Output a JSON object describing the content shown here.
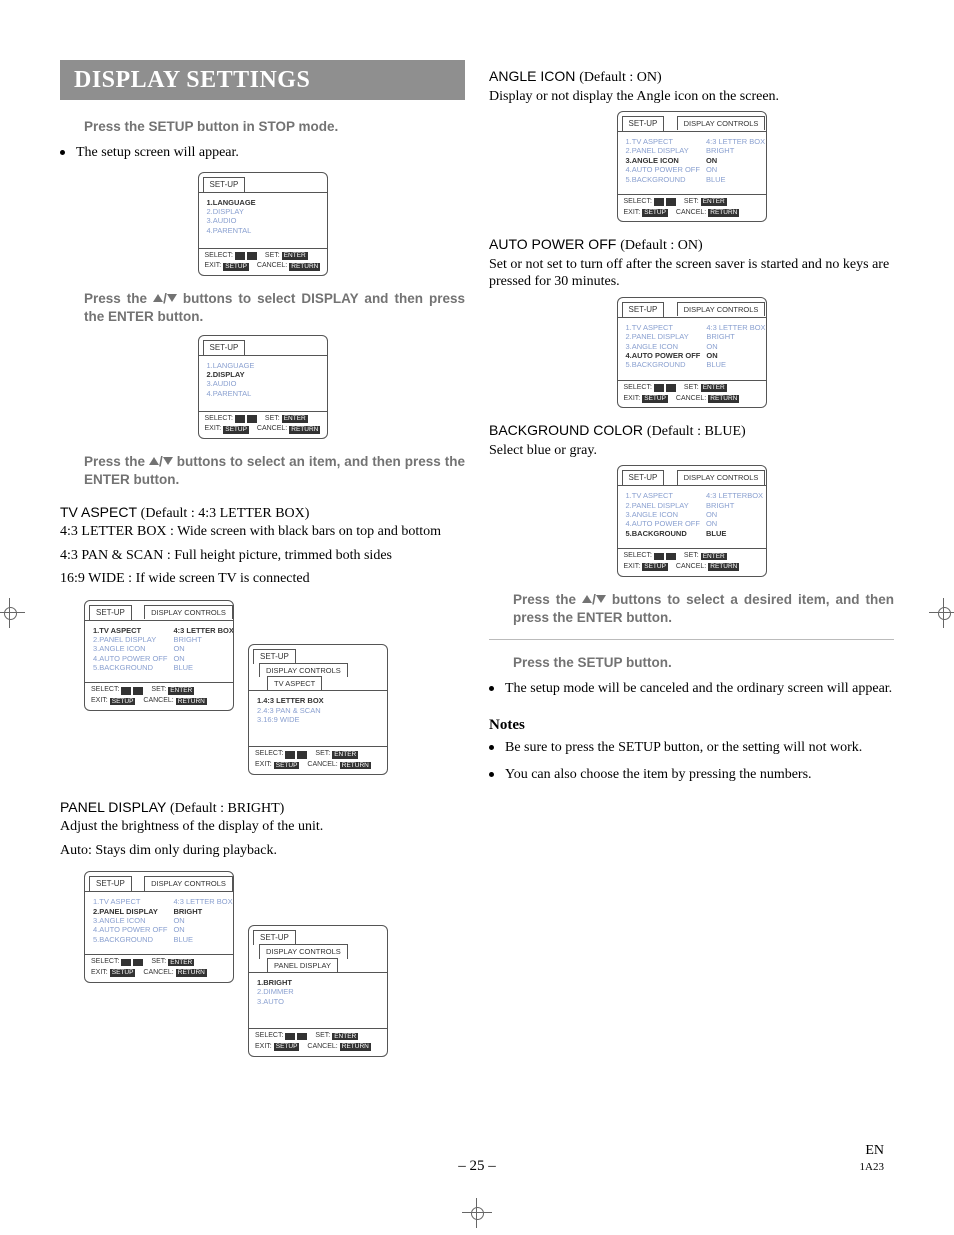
{
  "banner": "DISPLAY SETTINGS",
  "left": {
    "step1": "Press the SETUP button in STOP mode.",
    "step1_note": "The setup screen will appear.",
    "step2_a": "Press the ",
    "step2_b": " buttons to select DISPLAY and then press the ENTER button.",
    "step3_a": "Press the ",
    "step3_b": " buttons to select an item, and then press the ENTER button.",
    "tvaspect": {
      "title": "TV ASPECT",
      "def": "(Default : 4:3 LETTER BOX)",
      "l1": "4:3 LETTER BOX : Wide screen with black bars on top and bottom",
      "l2": "4:3 PAN & SCAN : Full height picture, trimmed both sides",
      "l3": "16:9 WIDE : If wide screen TV is connected"
    },
    "panel": {
      "title": "PANEL DISPLAY",
      "def": "(Default : BRIGHT)",
      "l1": "Adjust the brightness of the display of the unit.",
      "l2": "Auto: Stays dim only during playback."
    }
  },
  "right": {
    "angle": {
      "title": "ANGLE ICON",
      "def": "(Default : ON)",
      "body": "Display or not display the Angle icon on the screen."
    },
    "auto": {
      "title": "AUTO POWER OFF",
      "def": "(Default : ON)",
      "body": "Set or not set to turn off after the screen saver is started and no keys are pressed for 30 minutes."
    },
    "bg": {
      "title": "BACKGROUND COLOR",
      "def": "(Default : BLUE)",
      "body": "Select blue or gray."
    },
    "step4_a": "Press the ",
    "step4_b": " buttons to select a desired item, and then press the ENTER button.",
    "step5": "Press the SETUP button.",
    "step5_note": "The setup mode will be canceled and the ordinary screen will appear.",
    "notes": "Notes",
    "note1": "Be sure to press the SETUP button, or the setting will not work.",
    "note2": "You can also choose the item by pressing the numbers."
  },
  "osd": {
    "setup": "SET-UP",
    "dispctrl": "DISPLAY CONTROLS",
    "tvaspect_tab": "TV ASPECT",
    "paneldisp_tab": "PANEL DISPLAY",
    "mainmenu": [
      "1.LANGUAGE",
      "2.DISPLAY",
      "3.AUDIO",
      "4.PARENTAL"
    ],
    "dispmenu": {
      "rows": [
        {
          "k": "1.TV ASPECT",
          "v": "4:3 LETTER BOX"
        },
        {
          "k": "2.PANEL DISPLAY",
          "v": "BRIGHT"
        },
        {
          "k": "3.ANGLE ICON",
          "v": "ON"
        },
        {
          "k": "4.AUTO POWER OFF",
          "v": "ON"
        },
        {
          "k": "5.BACKGROUND",
          "v": "BLUE"
        }
      ]
    },
    "dispmenu_lb": {
      "rows": [
        {
          "k": "1.TV ASPECT",
          "v": "4:3 LETTERBOX"
        },
        {
          "k": "2.PANEL DISPLAY",
          "v": "BRIGHT"
        },
        {
          "k": "3.ANGLE ICON",
          "v": "ON"
        },
        {
          "k": "4.AUTO POWER OFF",
          "v": "ON"
        },
        {
          "k": "5.BACKGROUND",
          "v": "BLUE"
        }
      ]
    },
    "tvaspect_opts": [
      "1.4:3 LETTER BOX",
      "2.4:3 PAN & SCAN",
      "3.16:9 WIDE"
    ],
    "panel_opts": [
      "1.BRIGHT",
      "2.DIMMER",
      "3.AUTO"
    ],
    "foot": {
      "select": "SELECT:",
      "set": "SET:",
      "exit": "EXIT:",
      "cancel": "CANCEL:",
      "enter": "ENTER",
      "setup": "SETUP",
      "ret": "RETURN"
    }
  },
  "page_num": "– 25 –",
  "page_en": "EN",
  "page_code": "1A23"
}
